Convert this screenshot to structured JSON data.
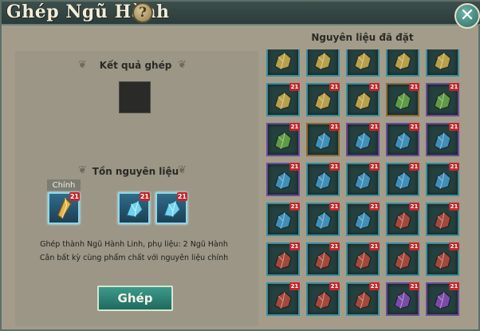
{
  "window": {
    "title": "Ghép Ngũ Hành",
    "help_label": "?",
    "close_label": "✕"
  },
  "result": {
    "label": "Kết quả ghép"
  },
  "materials": {
    "label": "Tồn nguyên liệu",
    "main_tag": "Chính",
    "slots": [
      {
        "count": "21",
        "kind": "gold",
        "icon": "gem-shard-icon"
      },
      {
        "count": "21",
        "kind": "blue",
        "icon": "crystal-icon"
      },
      {
        "count": "21",
        "kind": "blue",
        "icon": "crystal-icon"
      }
    ]
  },
  "description": "Ghép thành Ngũ Hành Linh, phụ liệu: 2 Ngũ Hành Cân bất kỳ cùng phẩm chất với nguyên liệu chính",
  "craft_button": "Ghép",
  "placed": {
    "label": "Nguyên liệu đã đặt",
    "rows": [
      [
        {
          "c": "gold",
          "n": ""
        },
        {
          "c": "gold",
          "n": ""
        },
        {
          "c": "gold",
          "n": ""
        },
        {
          "c": "gold",
          "n": ""
        },
        {
          "c": "gold",
          "n": ""
        }
      ],
      [
        {
          "c": "gold",
          "n": "21"
        },
        {
          "c": "gold",
          "n": "21"
        },
        {
          "c": "gold",
          "n": "21"
        },
        {
          "c": "green",
          "n": "21"
        },
        {
          "c": "green",
          "n": "21"
        }
      ],
      [
        {
          "c": "green",
          "n": "21"
        },
        {
          "c": "blue",
          "n": "21"
        },
        {
          "c": "blue",
          "n": "21"
        },
        {
          "c": "blue",
          "n": "21"
        },
        {
          "c": "blue",
          "n": "21"
        }
      ],
      [
        {
          "c": "blue",
          "n": "21"
        },
        {
          "c": "blue",
          "n": "21"
        },
        {
          "c": "blue",
          "n": "21"
        },
        {
          "c": "blue",
          "n": "21"
        },
        {
          "c": "blue",
          "n": "21"
        }
      ],
      [
        {
          "c": "blue",
          "n": "21"
        },
        {
          "c": "blue",
          "n": "21"
        },
        {
          "c": "blue",
          "n": "21"
        },
        {
          "c": "red",
          "n": "21"
        },
        {
          "c": "red",
          "n": "21"
        }
      ],
      [
        {
          "c": "red",
          "n": "21"
        },
        {
          "c": "red",
          "n": "21"
        },
        {
          "c": "red",
          "n": "21"
        },
        {
          "c": "red",
          "n": "21"
        },
        {
          "c": "red",
          "n": "21"
        }
      ],
      [
        {
          "c": "red",
          "n": "21"
        },
        {
          "c": "red",
          "n": "21"
        },
        {
          "c": "red",
          "n": "21"
        },
        {
          "c": "purple",
          "n": "21"
        },
        {
          "c": "purple",
          "n": "21"
        }
      ]
    ]
  },
  "colors": {
    "gold": "#b8a04a",
    "green": "#5f9a45",
    "blue": "#3f8fb8",
    "red": "#a3483b",
    "purple": "#7a4aa8",
    "frame_teal": "#3a8c9a",
    "frame_brown": "#8a6a3a",
    "frame_purple": "#6a4a9a"
  }
}
